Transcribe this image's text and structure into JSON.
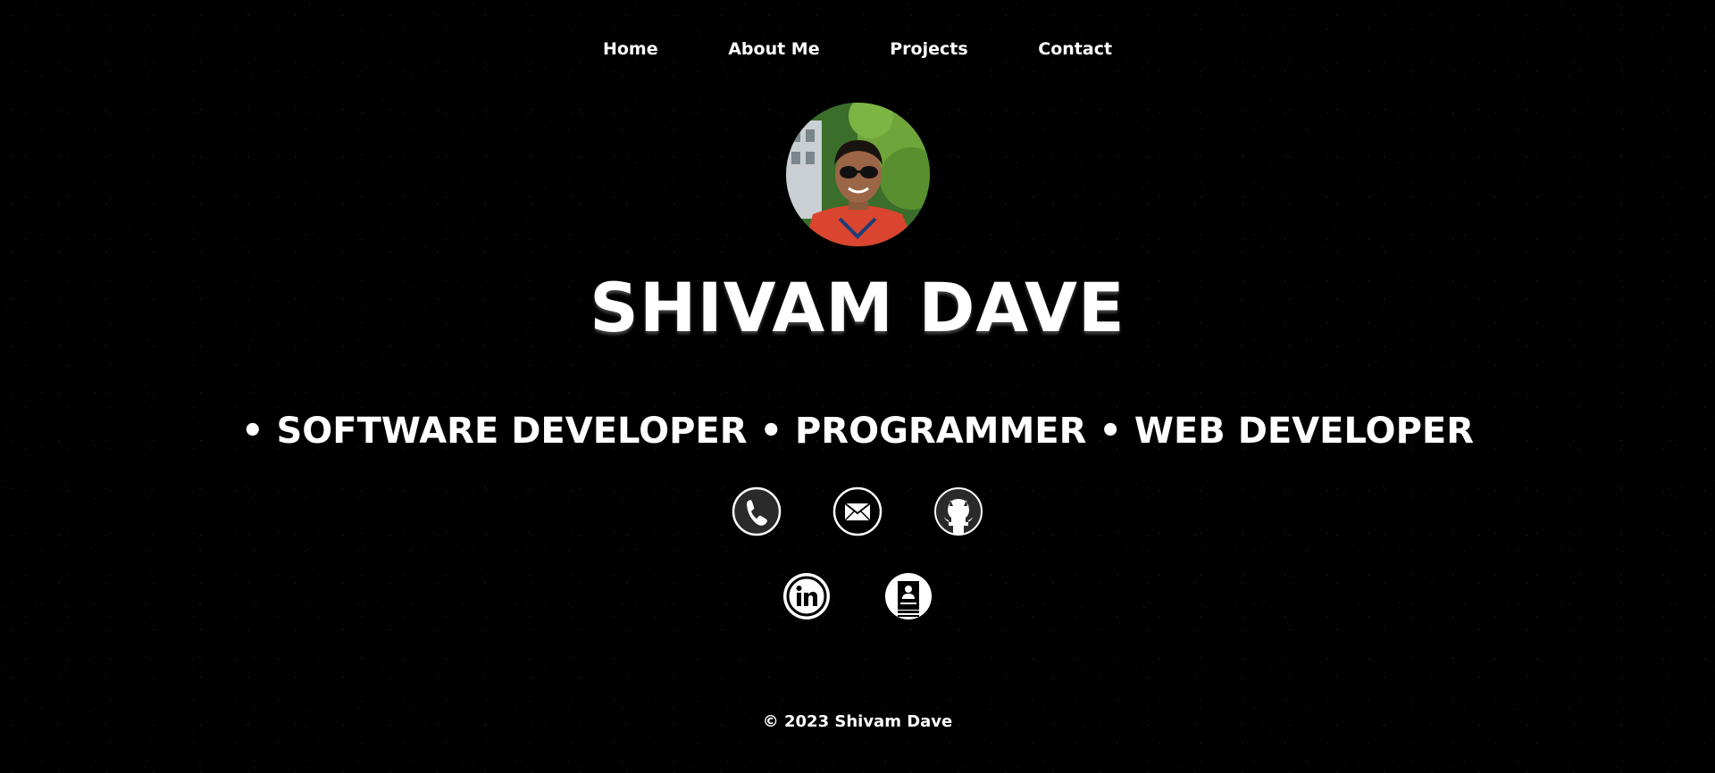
{
  "nav": {
    "items": [
      {
        "label": "Home"
      },
      {
        "label": "About Me"
      },
      {
        "label": "Projects"
      },
      {
        "label": "Contact"
      }
    ]
  },
  "hero": {
    "name": "SHIVAM DAVE",
    "roles": "• SOFTWARE DEVELOPER • PROGRAMMER • WEB DEVELOPER"
  },
  "icons": {
    "row1": [
      "phone-icon",
      "mail-icon",
      "github-icon"
    ],
    "row2": [
      "linkedin-icon",
      "resume-icon"
    ]
  },
  "footer": {
    "text": "© 2023 Shivam Dave"
  },
  "colors": {
    "background": "#000000",
    "text": "#ffffff"
  }
}
